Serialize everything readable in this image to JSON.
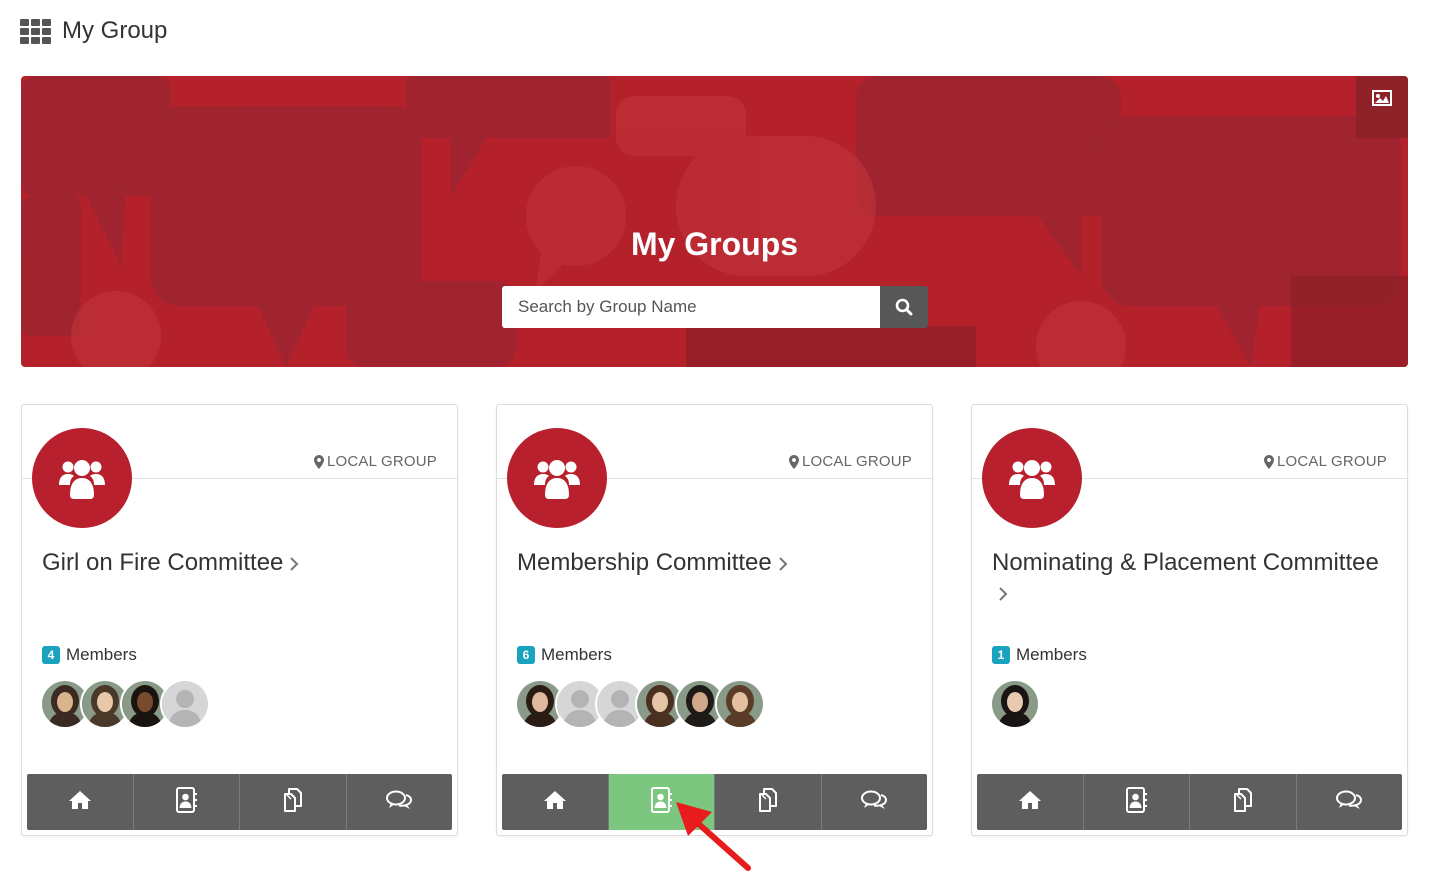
{
  "page": {
    "title": "My Group"
  },
  "hero": {
    "title": "My Groups",
    "search_placeholder": "Search by Group Name",
    "color": "#b5212b"
  },
  "groups": [
    {
      "name": "Girl on Fire Committee",
      "location": "LOCAL GROUP",
      "member_count": "4",
      "members_label": "Members",
      "active_tab": null
    },
    {
      "name": "Membership Committee",
      "location": "LOCAL GROUP",
      "member_count": "6",
      "members_label": "Members",
      "active_tab": "directory"
    },
    {
      "name": "Nominating & Placement Committee",
      "location": "LOCAL GROUP",
      "member_count": "1",
      "members_label": "Members",
      "active_tab": null
    }
  ],
  "toolbar_icons": [
    "home-icon",
    "directory-icon",
    "documents-icon",
    "discussion-icon"
  ],
  "colors": {
    "accent": "#b8202d",
    "badge": "#1aa3c0",
    "toolbar": "#5e5e5e",
    "active_tab": "#7dc67f"
  }
}
